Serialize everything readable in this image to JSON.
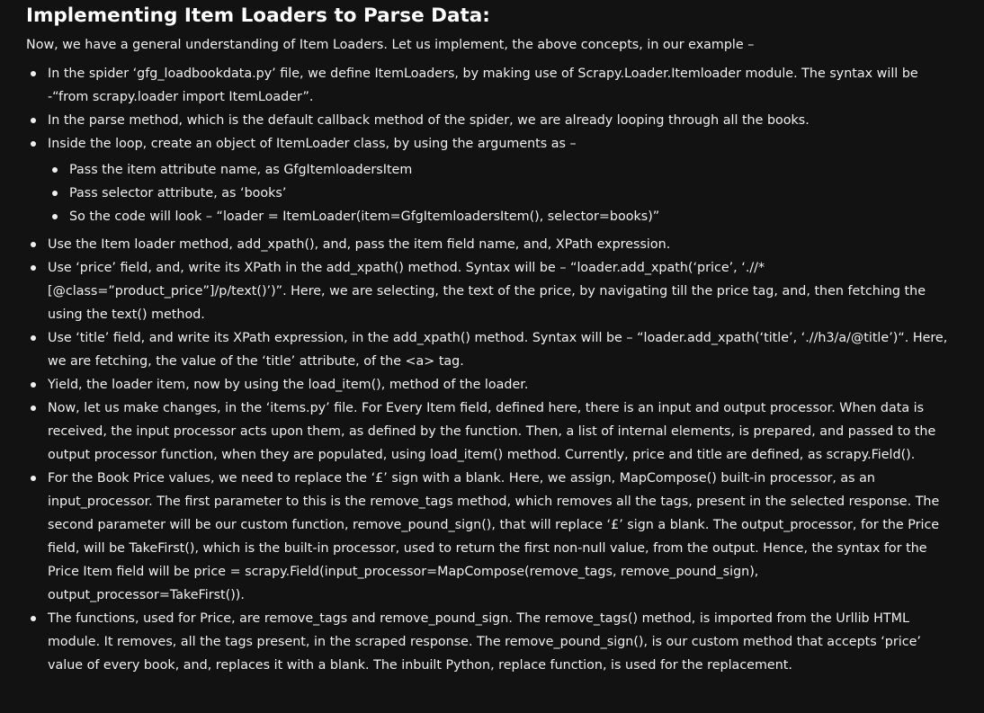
{
  "heading": "Implementing Item Loaders to Parse Data:",
  "intro": "Now, we have a general understanding of Item Loaders. Let us implement, the above concepts, in our example –",
  "bullets": [
    "In the spider ‘gfg_loadbookdata.py’ file, we define ItemLoaders, by making use of  Scrapy.Loader.Itemloader module. The syntax will be -“from scrapy.loader import ItemLoader”.",
    "In the parse method, which is the default callback method of the spider, we are already looping through all the books.",
    "Inside the loop, create an object of ItemLoader class, by using the arguments as –",
    "Use the Item loader method, add_xpath(), and, pass the item field name, and, XPath expression.",
    "Use ‘price’ field, and, write its XPath in the add_xpath() method. Syntax will be – “loader.add_xpath(‘price’, ‘.//*[@class=”product_price”]/p/text()’)”. Here, we are selecting, the text of the price, by navigating till the price tag, and, then fetching the  using the text() method.",
    "Use ‘title’ field, and write its XPath expression, in the add_xpath() method. Syntax will be – “loader.add_xpath(‘title’, ‘.//h3/a/@title’)“. Here, we are fetching, the value of the ‘title’ attribute, of the <a> tag.",
    "Yield, the loader item, now by using the load_item(), method of the loader.",
    "Now, let us make changes, in the ‘items.py’ file. For Every Item field, defined here, there is an input and output processor. When data is received, the input processor acts upon them, as defined by the function. Then, a list of internal elements, is prepared, and passed to the output processor function, when they are populated, using load_item() method. Currently, price and title are defined, as scrapy.Field().",
    "For the Book Price values, we need to replace the ‘£’ sign with a blank. Here,  we assign, MapCompose() built-in processor, as an input_processor. The first parameter to this is the remove_tags method, which removes all the tags, present in the selected response. The second parameter will be our custom function, remove_pound_sign(), that will replace ‘£’ sign a blank. The output_processor, for the Price field, will be TakeFirst(), which is the built-in processor, used to return the first non-null value, from the output. Hence, the syntax for the Price Item field will be price = scrapy.Field(input_processor=MapCompose(remove_tags, remove_pound_sign), output_processor=TakeFirst()).",
    "The functions, used for Price, are remove_tags and remove_pound_sign. The remove_tags() method, is imported from the Urllib HTML module. It removes, all the tags present, in the scraped response. The remove_pound_sign(), is our custom method that accepts ‘price’ value of every book, and, replaces it with a blank. The inbuilt Python, replace function, is used for the replacement."
  ],
  "sub_bullets": [
    "Pass the item attribute name, as GfgItemloadersItem",
    "Pass selector attribute, as ‘books’",
    "So the code will look –  “loader = ItemLoader(item=GfgItemloadersItem(), selector=books)”"
  ]
}
